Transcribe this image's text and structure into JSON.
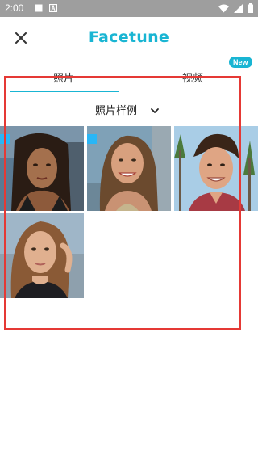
{
  "status": {
    "time": "2:00",
    "icons": [
      "notification-box-icon",
      "notification-a-icon",
      "wifi-icon",
      "signal-icon",
      "battery-icon"
    ]
  },
  "appbar": {
    "title": "Facetune",
    "close_icon": "close-icon",
    "accent": "#19b5d3"
  },
  "tabs": {
    "items": [
      {
        "label": "照片",
        "selected": true
      },
      {
        "label": "视频",
        "selected": false
      }
    ],
    "new_badge": "New"
  },
  "filter": {
    "label": "照片样例",
    "icon": "chevron-down-icon"
  },
  "gallery": {
    "photos": [
      {
        "name": "portrait-1"
      },
      {
        "name": "portrait-2"
      },
      {
        "name": "portrait-3"
      },
      {
        "name": "portrait-4"
      }
    ]
  }
}
